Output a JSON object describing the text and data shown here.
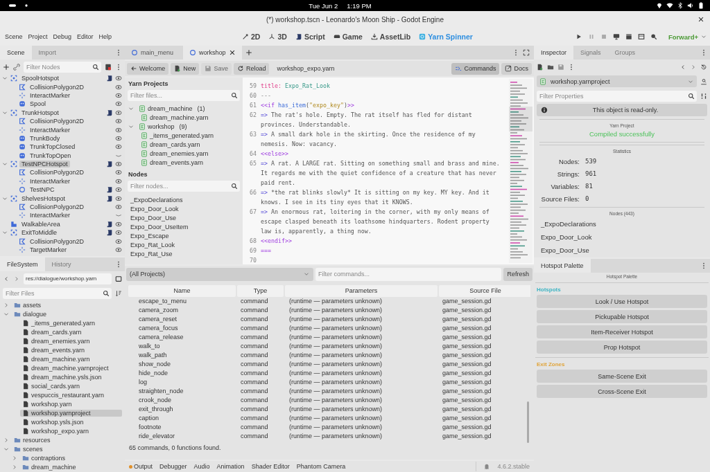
{
  "status_bar": {
    "date": "Tue Jun 2",
    "time": "1:19 PM"
  },
  "window": {
    "title": "(*) workshop.tscn - Leonardo's Moon Ship - Godot Engine"
  },
  "menu": [
    "Scene",
    "Project",
    "Debug",
    "Editor",
    "Help"
  ],
  "workspaces": [
    {
      "label": "2D",
      "kind": "planar",
      "selected": false
    },
    {
      "label": "3D",
      "kind": "spatial",
      "selected": false
    },
    {
      "label": "Script",
      "kind": "script",
      "selected": false
    },
    {
      "label": "Game",
      "kind": "game",
      "selected": false
    },
    {
      "label": "AssetLib",
      "kind": "assetlib",
      "selected": false
    },
    {
      "label": "Yarn Spinner",
      "kind": "yarn",
      "selected": true
    }
  ],
  "renderer": "Forward+",
  "scene_dock": {
    "tabs": [
      {
        "label": "Scene",
        "selected": true
      },
      {
        "label": "Import",
        "selected": false
      }
    ],
    "filter_placeholder": "Filter Nodes",
    "tree": [
      {
        "name": "SpoolHotspot",
        "kind": "area",
        "script": true,
        "visible": true,
        "expanded": true,
        "selected": false,
        "children": [
          {
            "name": "CollisionPolygon2D",
            "kind": "polygon",
            "script": false,
            "visible": true,
            "selected": false
          },
          {
            "name": "InteractMarker",
            "kind": "marker",
            "script": false,
            "visible": true,
            "selected": false
          },
          {
            "name": "Spool",
            "kind": "sprite",
            "script": false,
            "visible": true,
            "selected": false
          }
        ]
      },
      {
        "name": "TrunkHotspot",
        "kind": "area",
        "script": true,
        "visible": true,
        "expanded": true,
        "selected": false,
        "children": [
          {
            "name": "CollisionPolygon2D",
            "kind": "polygon",
            "script": false,
            "visible": true,
            "selected": false
          },
          {
            "name": "InteractMarker",
            "kind": "marker",
            "script": false,
            "visible": true,
            "selected": false
          },
          {
            "name": "TrunkBody",
            "kind": "sprite",
            "script": false,
            "visible": true,
            "selected": false
          },
          {
            "name": "TrunkTopClosed",
            "kind": "sprite",
            "script": false,
            "visible": true,
            "selected": false
          },
          {
            "name": "TrunkTopOpen",
            "kind": "sprite",
            "script": false,
            "visible": false,
            "selected": false
          }
        ]
      },
      {
        "name": "TestNPCHotspot",
        "kind": "area",
        "script": true,
        "visible": true,
        "expanded": true,
        "selected": true,
        "children": [
          {
            "name": "CollisionPolygon2D",
            "kind": "polygon",
            "script": false,
            "visible": true,
            "selected": false
          },
          {
            "name": "InteractMarker",
            "kind": "marker",
            "script": false,
            "visible": true,
            "selected": false
          },
          {
            "name": "TestNPC",
            "kind": "ring",
            "script": true,
            "visible": true,
            "selected": false
          }
        ]
      },
      {
        "name": "ShelvesHotspot",
        "kind": "area",
        "script": true,
        "visible": true,
        "expanded": true,
        "selected": false,
        "children": [
          {
            "name": "CollisionPolygon2D",
            "kind": "polygon",
            "script": false,
            "visible": true,
            "selected": false
          },
          {
            "name": "InteractMarker",
            "kind": "marker",
            "script": false,
            "visible": false,
            "selected": false
          }
        ]
      },
      {
        "name": "WalkableArea",
        "kind": "walkable",
        "script": true,
        "visible": true,
        "selected": false
      },
      {
        "name": "ExitToMiddle",
        "kind": "area",
        "script": true,
        "visible": true,
        "expanded": true,
        "selected": false,
        "children": [
          {
            "name": "CollisionPolygon2D",
            "kind": "polygon",
            "script": false,
            "visible": true,
            "selected": false
          },
          {
            "name": "TargetMarker",
            "kind": "marker",
            "script": false,
            "visible": true,
            "selected": false
          }
        ]
      }
    ]
  },
  "filesystem": {
    "tabs": [
      {
        "label": "FileSystem",
        "selected": true
      },
      {
        "label": "History",
        "selected": false
      }
    ],
    "path": "res://dialogue/workshop.yarn",
    "filter_placeholder": "Filter Files",
    "tree": [
      {
        "name": "assets",
        "kind": "folder",
        "expanded": false,
        "selected": false
      },
      {
        "name": "dialogue",
        "kind": "folder",
        "expanded": true,
        "selected": false,
        "children": [
          {
            "name": "_items_generated.yarn",
            "kind": "file",
            "selected": false
          },
          {
            "name": "dream_cards.yarn",
            "kind": "file",
            "selected": false
          },
          {
            "name": "dream_enemies.yarn",
            "kind": "file",
            "selected": false
          },
          {
            "name": "dream_events.yarn",
            "kind": "file",
            "selected": false
          },
          {
            "name": "dream_machine.yarn",
            "kind": "file",
            "selected": false
          },
          {
            "name": "dream_machine.yarnproject",
            "kind": "file",
            "selected": false
          },
          {
            "name": "dream_machine.ysls.json",
            "kind": "file",
            "selected": false
          },
          {
            "name": "social_cards.yarn",
            "kind": "file",
            "selected": false
          },
          {
            "name": "vespuccis_restaurant.yarn",
            "kind": "file",
            "selected": false
          },
          {
            "name": "workshop.yarn",
            "kind": "file",
            "selected": false
          },
          {
            "name": "workshop.yarnproject",
            "kind": "file",
            "selected": true
          },
          {
            "name": "workshop.ysls.json",
            "kind": "file",
            "selected": false
          },
          {
            "name": "workshop_expo.yarn",
            "kind": "file",
            "selected": false
          }
        ]
      },
      {
        "name": "resources",
        "kind": "folder",
        "expanded": false,
        "selected": false
      },
      {
        "name": "scenes",
        "kind": "folder",
        "expanded": true,
        "selected": false,
        "children": [
          {
            "name": "contraptions",
            "kind": "folder",
            "expanded": false,
            "selected": false
          },
          {
            "name": "dream_machine",
            "kind": "folder",
            "expanded": false,
            "selected": false
          }
        ]
      }
    ]
  },
  "editor_tabs": [
    {
      "label": "main_menu",
      "selected": false
    },
    {
      "label": "workshop",
      "selected": true
    }
  ],
  "yarn_toolbar": {
    "buttons": [
      {
        "label": "Welcome",
        "kind": "back",
        "disabled": false
      },
      {
        "label": "New",
        "kind": "new",
        "disabled": false
      },
      {
        "label": "Save",
        "kind": "save",
        "disabled": true
      },
      {
        "label": "Reload",
        "kind": "reload",
        "disabled": false
      }
    ],
    "file": "workshop_expo.yarn",
    "right_buttons": [
      {
        "label": "Commands",
        "kind": "commands",
        "selected": true
      },
      {
        "label": "Docs",
        "kind": "docs",
        "selected": false
      }
    ]
  },
  "yarn_projects": {
    "title": "Yarn Projects",
    "filter_placeholder": "Filter files...",
    "tree": [
      {
        "name": "dream_machine",
        "count": "(1)",
        "expanded": true,
        "selected": false,
        "children": [
          {
            "name": "dream_machine.yarn",
            "selected": false
          }
        ]
      },
      {
        "name": "workshop",
        "count": "(9)",
        "expanded": true,
        "selected": false,
        "children": [
          {
            "name": "_items_generated.yarn",
            "selected": false
          },
          {
            "name": "dream_cards.yarn",
            "selected": false
          },
          {
            "name": "dream_enemies.yarn",
            "selected": false
          },
          {
            "name": "dream_events.yarn",
            "selected": false
          }
        ]
      }
    ]
  },
  "nodes": {
    "title": "Nodes",
    "filter_placeholder": "Filter nodes...",
    "items": [
      {
        "name": "_ExpoDeclarations",
        "selected": false
      },
      {
        "name": "Expo_Door_Look",
        "selected": false
      },
      {
        "name": "Expo_Door_Use",
        "selected": false
      },
      {
        "name": "Expo_Door_UseItem",
        "selected": false
      },
      {
        "name": "Expo_Escape",
        "selected": false
      },
      {
        "name": "Expo_Rat_Look",
        "selected": false
      },
      {
        "name": "Expo_Rat_Use",
        "selected": false
      }
    ]
  },
  "code": {
    "lines": [
      {
        "number": "59",
        "segments": [
          {
            "kind": "key",
            "text": "title:"
          },
          {
            "kind": "title",
            "text": " Expo_Rat_Look"
          }
        ]
      },
      {
        "number": "60",
        "segments": [
          {
            "kind": "sep",
            "text": "---"
          }
        ]
      },
      {
        "number": "61",
        "segments": [
          {
            "kind": "kw",
            "text": "<<if "
          },
          {
            "kind": "func",
            "text": "has_item"
          },
          {
            "kind": "text",
            "text": "("
          },
          {
            "kind": "str",
            "text": "\"expo_key\""
          },
          {
            "kind": "text",
            "text": ")"
          },
          {
            "kind": "kw",
            "text": ">>"
          }
        ]
      },
      {
        "number": "62",
        "segments": [
          {
            "kind": "arrow",
            "text": "=>"
          },
          {
            "kind": "text",
            "text": " The rat's hole. Empty. The rat itself has fled for distant provinces. Understandable."
          }
        ]
      },
      {
        "number": "63",
        "segments": [
          {
            "kind": "arrow",
            "text": "=>"
          },
          {
            "kind": "text",
            "text": " A small dark hole in the skirting. Once the residence of my nemesis. Now: vacancy."
          }
        ]
      },
      {
        "number": "64",
        "segments": [
          {
            "kind": "kw",
            "text": "<<else>>"
          }
        ]
      },
      {
        "number": "65",
        "segments": [
          {
            "kind": "arrow",
            "text": "=>"
          },
          {
            "kind": "text",
            "text": " A rat. A LARGE rat. Sitting on something small and brass and mine. It regards me with the quiet confidence of a creature that has never paid rent."
          }
        ]
      },
      {
        "number": "66",
        "segments": [
          {
            "kind": "arrow",
            "text": "=>"
          },
          {
            "kind": "text",
            "text": " *the rat blinks slowly* It is sitting on my key. MY key. And it knows. I see in its tiny eyes that it KNOWS."
          }
        ]
      },
      {
        "number": "67",
        "segments": [
          {
            "kind": "arrow",
            "text": "=>"
          },
          {
            "kind": "text",
            "text": " An enormous rat, loitering in the corner, with my only means of escape clasped beneath its loathsome hindquarters. Rodent property law is, apparently, a thing now."
          }
        ]
      },
      {
        "number": "68",
        "segments": [
          {
            "kind": "kw",
            "text": "<<endif>>"
          }
        ]
      },
      {
        "number": "69",
        "segments": [
          {
            "kind": "kw",
            "text": "==="
          }
        ]
      },
      {
        "number": "70"
      }
    ]
  },
  "commands": {
    "project": "(All Projects)",
    "filter_placeholder": "Filter commands...",
    "refresh": "Refresh",
    "columns": [
      "Name",
      "Type",
      "Parameters",
      "Source File"
    ],
    "rows": [
      [
        "escape_to_menu",
        "command",
        "(runtime — parameters unknown)",
        "game_session.gd"
      ],
      [
        "camera_zoom",
        "command",
        "(runtime — parameters unknown)",
        "game_session.gd"
      ],
      [
        "camera_reset",
        "command",
        "(runtime — parameters unknown)",
        "game_session.gd"
      ],
      [
        "camera_focus",
        "command",
        "(runtime — parameters unknown)",
        "game_session.gd"
      ],
      [
        "camera_release",
        "command",
        "(runtime — parameters unknown)",
        "game_session.gd"
      ],
      [
        "walk_to",
        "command",
        "(runtime — parameters unknown)",
        "game_session.gd"
      ],
      [
        "walk_path",
        "command",
        "(runtime — parameters unknown)",
        "game_session.gd"
      ],
      [
        "show_node",
        "command",
        "(runtime — parameters unknown)",
        "game_session.gd"
      ],
      [
        "hide_node",
        "command",
        "(runtime — parameters unknown)",
        "game_session.gd"
      ],
      [
        "log",
        "command",
        "(runtime — parameters unknown)",
        "game_session.gd"
      ],
      [
        "straighten_node",
        "command",
        "(runtime — parameters unknown)",
        "game_session.gd"
      ],
      [
        "crook_node",
        "command",
        "(runtime — parameters unknown)",
        "game_session.gd"
      ],
      [
        "exit_through",
        "command",
        "(runtime — parameters unknown)",
        "game_session.gd"
      ],
      [
        "caption",
        "command",
        "(runtime — parameters unknown)",
        "game_session.gd"
      ],
      [
        "footnote",
        "command",
        "(runtime — parameters unknown)",
        "game_session.gd"
      ],
      [
        "ride_elevator",
        "command",
        "(runtime — parameters unknown)",
        "game_session.gd"
      ]
    ],
    "summary": "65 commands, 0 functions found."
  },
  "bottom_panel": {
    "tabs": [
      {
        "label": "Output",
        "alert": true
      },
      {
        "label": "Debugger",
        "alert": false
      },
      {
        "label": "Audio",
        "alert": false
      },
      {
        "label": "Animation",
        "alert": false
      },
      {
        "label": "Shader Editor",
        "alert": false
      },
      {
        "label": "Phantom Camera",
        "alert": false
      }
    ],
    "version": "4.6.2.stable"
  },
  "inspector": {
    "tabs": [
      {
        "label": "Inspector",
        "selected": true
      },
      {
        "label": "Signals",
        "selected": false
      },
      {
        "label": "Groups",
        "selected": false
      }
    ],
    "resource": "workshop.yarnproject",
    "filter_placeholder": "Filter Properties",
    "notice": "This object is read-only.",
    "project_heading": "Yarn Project",
    "status": "Compiled successfully",
    "stats_heading": "Statistics",
    "stats": [
      {
        "label": "Nodes:",
        "value": "539"
      },
      {
        "label": "Strings:",
        "value": "961"
      },
      {
        "label": "Variables:",
        "value": "81"
      },
      {
        "label": "Source Files:",
        "value": "0"
      }
    ],
    "nodes_heading": "Nodes (443)",
    "nodes": [
      "_ExpoDeclarations",
      "Expo_Door_Look",
      "Expo_Door_Use"
    ]
  },
  "hotspot_palette": {
    "tabs": [
      {
        "label": "Hotspot Palette",
        "selected": true
      }
    ],
    "heading": "Hotspot Palette",
    "groups": [
      {
        "title": "Hotspots",
        "color": "#3fb5c4",
        "buttons": [
          "Look / Use Hotspot",
          "Pickupable Hotspot",
          "Item-Receiver Hotspot",
          "Prop Hotspot"
        ]
      },
      {
        "title": "Exit Zones",
        "color": "#e0a43a",
        "buttons": [
          "Same-Scene Exit",
          "Cross-Scene Exit"
        ]
      }
    ]
  }
}
